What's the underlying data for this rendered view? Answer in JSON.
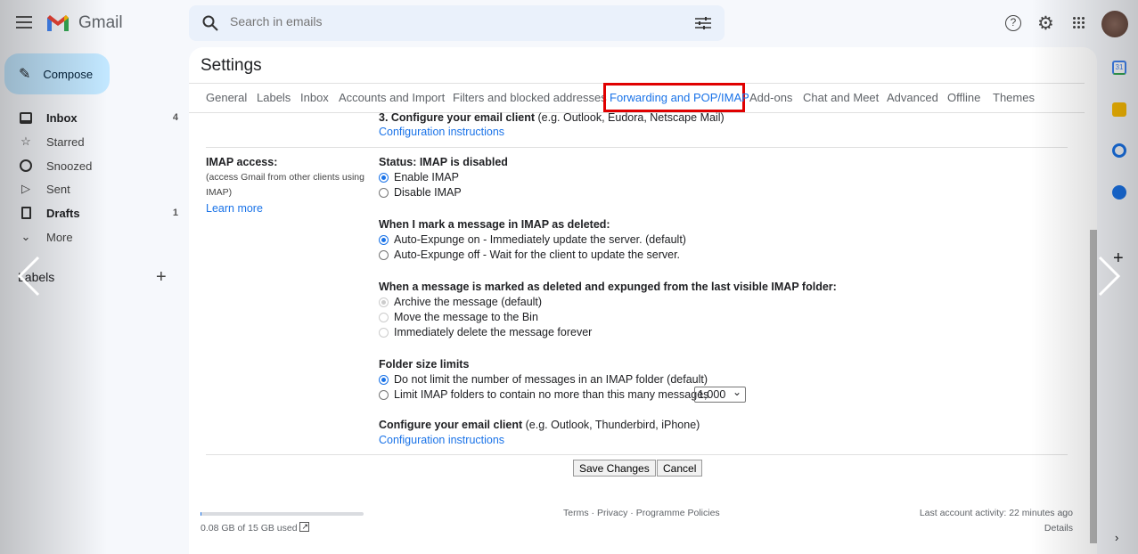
{
  "app": {
    "name": "Gmail"
  },
  "search": {
    "placeholder": "Search in emails"
  },
  "sidebar": {
    "compose": "Compose",
    "items": [
      {
        "label": "Inbox",
        "count": "4",
        "icon": "inbox-icon"
      },
      {
        "label": "Starred",
        "count": "",
        "icon": "star-icon"
      },
      {
        "label": "Snoozed",
        "count": "",
        "icon": "clock-icon"
      },
      {
        "label": "Sent",
        "count": "",
        "icon": "send-icon"
      },
      {
        "label": "Drafts",
        "count": "1",
        "icon": "draft-icon"
      },
      {
        "label": "More",
        "count": "",
        "icon": "chevron-down-icon"
      }
    ],
    "labels_heading": "Labels"
  },
  "settings": {
    "title": "Settings",
    "active_tab": "Forwarding and POP/IMAP",
    "highlight_color": "#e00000",
    "tabs": [
      "General",
      "Labels",
      "Inbox",
      "Accounts and Import",
      "Filters and blocked addresses",
      "Forwarding and POP/IMAP",
      "Add-ons",
      "Chat and Meet",
      "Advanced",
      "Offline",
      "Themes"
    ]
  },
  "pop": {
    "configure_bold": "3. Configure your email client",
    "configure_rest": " (e.g. Outlook, Eudora, Netscape Mail)",
    "config_link": "Configuration instructions"
  },
  "imap": {
    "label": "IMAP access:",
    "desc1": "(access Gmail from other clients using",
    "desc2": "IMAP)",
    "learn_more": "Learn more",
    "status": "Status: IMAP is disabled",
    "enable": "Enable IMAP",
    "disable": "Disable IMAP",
    "deleted_heading": "When I mark a message in IMAP as deleted:",
    "expunge_on": "Auto-Expunge on - Immediately update the server. (default)",
    "expunge_off": "Auto-Expunge off - Wait for the client to update the server.",
    "expunged_heading": "When a message is marked as deleted and expunged from the last visible IMAP folder:",
    "archive": "Archive the message (default)",
    "bin": "Move the message to the Bin",
    "delete_forever": "Immediately delete the message forever",
    "folder_heading": "Folder size limits",
    "no_limit": "Do not limit the number of messages in an IMAP folder (default)",
    "limit": "Limit IMAP folders to contain no more than this many messages",
    "limit_value": "1,000",
    "client_bold": "Configure your email client",
    "client_rest": " (e.g. Outlook, Thunderbird, iPhone)",
    "client_link": "Configuration instructions"
  },
  "actions": {
    "save": "Save Changes",
    "cancel": "Cancel"
  },
  "footer": {
    "storage": "0.08 GB of 15 GB used",
    "storage_fraction": 0.005,
    "terms": "Terms",
    "privacy": "Privacy",
    "policies": "Programme Policies",
    "sep": " · ",
    "activity": "Last account activity: 22 minutes ago",
    "details": "Details"
  }
}
